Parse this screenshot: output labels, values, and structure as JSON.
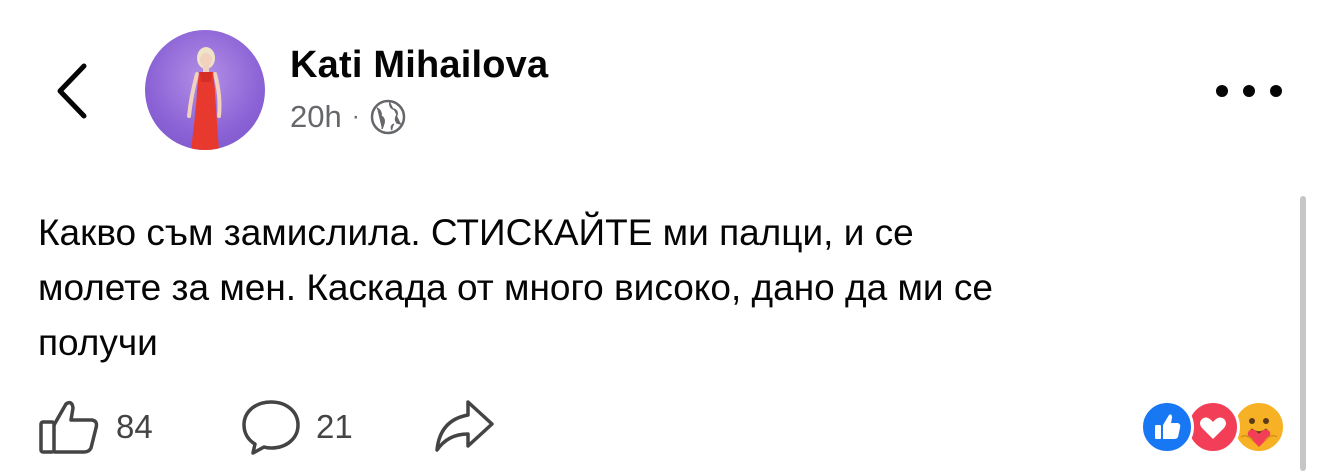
{
  "post": {
    "author_name": "Kati Mihailova",
    "time_ago": "20h",
    "separator": "·",
    "privacy_icon": "globe-icon",
    "text": "Какво съм замислила. СТИСКАЙТЕ ми палци, и се\nмолете за мен. Каскада от много високо, дано да ми се\nполучи"
  },
  "actions": {
    "like_count": "84",
    "comment_count": "21"
  },
  "icons": {
    "back": "chevron-left-icon",
    "more": "more-dots-icon",
    "like": "thumbs-up-icon",
    "comment": "comment-bubble-icon",
    "share": "share-arrow-icon"
  },
  "reactions": [
    "like",
    "love",
    "care"
  ],
  "colors": {
    "like_blue": "#1877f2",
    "love_red": "#f33e58",
    "care_yellow": "#f7b125",
    "avatar_bg": "#8b63d6",
    "dress_red": "#e8392f"
  }
}
